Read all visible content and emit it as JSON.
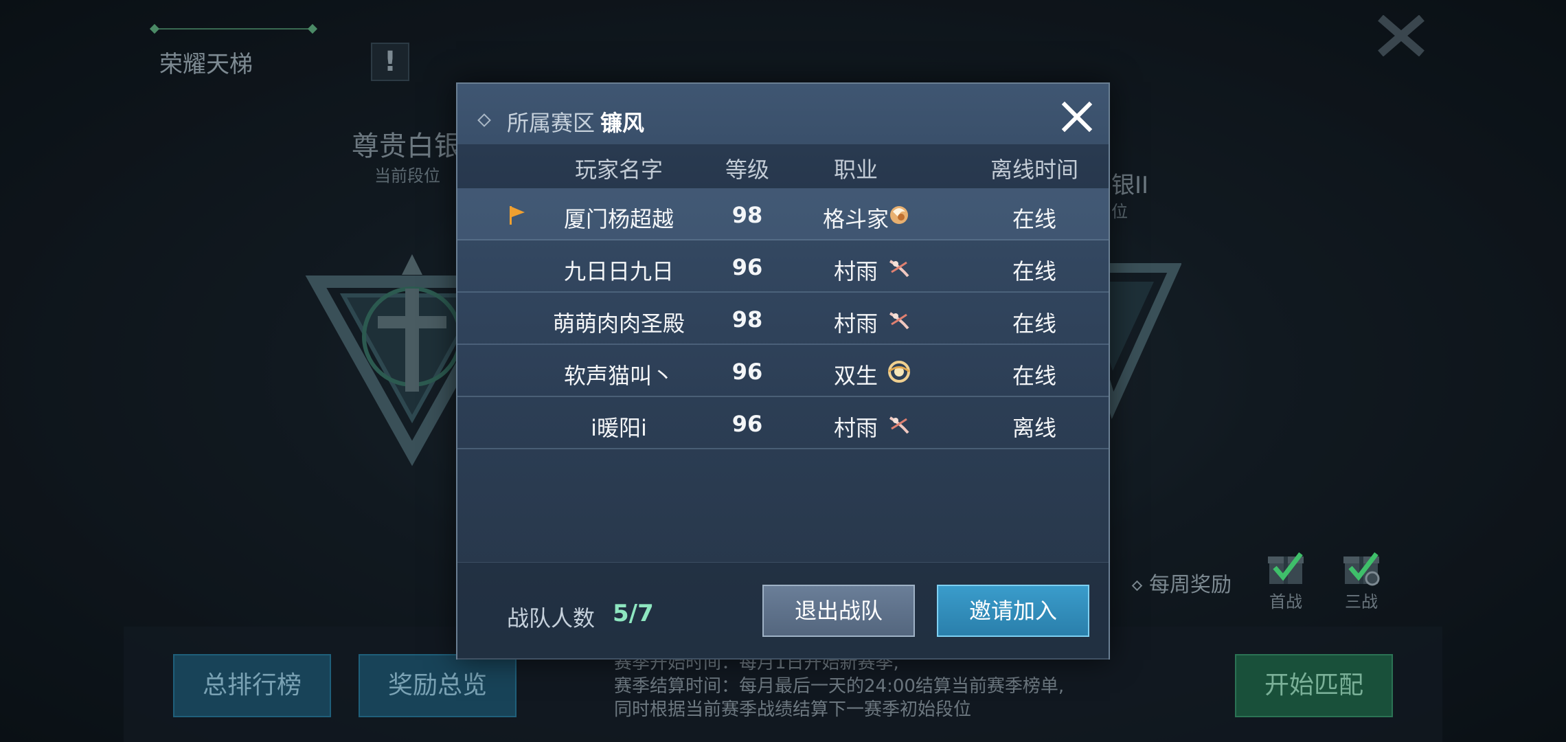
{
  "background": {
    "ladder_title": "荣耀天梯",
    "warn_symbol": "!",
    "current_rank": "尊贵白银",
    "current_rank_sub": "当前段位",
    "next_rank": "银II",
    "next_rank_sub": "位",
    "weekly_reward": "每周奖励",
    "gift_first_label": "首战",
    "gift_third_label": "三战",
    "btn_leaderboard": "总排行榜",
    "btn_rewards": "奖励总览",
    "btn_start_match": "开始匹配",
    "notes": [
      "赛季开始时间：每月1日开始新赛季,",
      "赛季结算时间：每月最后一天的24:00结算当前赛季榜单,",
      "同时根据当前赛季战绩结算下一赛季初始段位"
    ],
    "colors": {
      "accent_green": "#3a6a52",
      "button_blue": "#184358",
      "button_green": "#19503a"
    }
  },
  "dialog": {
    "zone_label": "所属赛区",
    "zone_value": "镰风",
    "columns": [
      "玩家名字",
      "等级",
      "职业",
      "离线时间"
    ],
    "rows": [
      {
        "name": "厦门杨超越",
        "level": "98",
        "class": "格斗家",
        "class_icon": "fighter-icon",
        "status": "在线",
        "leader": true
      },
      {
        "name": "九日日九日",
        "level": "96",
        "class": "村雨",
        "class_icon": "murasame-icon",
        "status": "在线",
        "leader": false
      },
      {
        "name": "萌萌肉肉圣殿",
        "level": "98",
        "class": "村雨",
        "class_icon": "murasame-icon",
        "status": "在线",
        "leader": false
      },
      {
        "name": "软声猫叫丶",
        "level": "96",
        "class": "双生",
        "class_icon": "twin-icon",
        "status": "在线",
        "leader": false
      },
      {
        "name": "i暖阳i",
        "level": "96",
        "class": "村雨",
        "class_icon": "murasame-icon",
        "status": "离线",
        "leader": false
      }
    ],
    "team_count_label": "战队人数",
    "team_count_value": "5/7",
    "btn_quit": "退出战队",
    "btn_invite": "邀请加入",
    "colors": {
      "count_color": "#8ee6c0",
      "invite_blue": "#3a9ccb",
      "quit_grey": "#6a7e98",
      "leader_flag": "#f0a030"
    }
  }
}
